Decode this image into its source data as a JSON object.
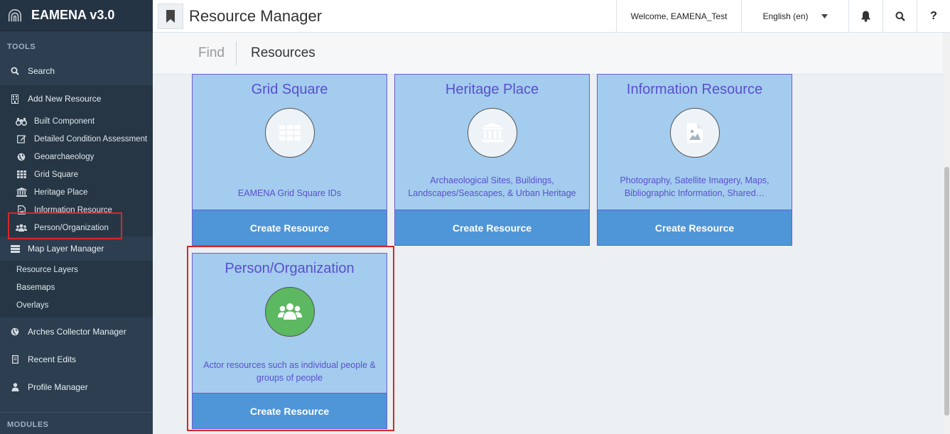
{
  "app": {
    "brand": "EAMENA v3.0"
  },
  "sidebar": {
    "tools_title": "TOOLS",
    "search": "Search",
    "add_new_resource": "Add New Resource",
    "resource_items": [
      {
        "label": "Built Component",
        "icon": "binoculars-icon"
      },
      {
        "label": "Detailed Condition Assessment",
        "icon": "edit-icon"
      },
      {
        "label": "Geoarchaeology",
        "icon": "globe-icon"
      },
      {
        "label": "Grid Square",
        "icon": "grid-icon"
      },
      {
        "label": "Heritage Place",
        "icon": "institution-icon"
      },
      {
        "label": "Information Resource",
        "icon": "image-file-icon"
      },
      {
        "label": "Person/Organization",
        "icon": "users-icon"
      }
    ],
    "map_layer_manager": "Map Layer Manager",
    "map_items": [
      "Resource Layers",
      "Basemaps",
      "Overlays"
    ],
    "arches_collector_manager": "Arches Collector Manager",
    "recent_edits": "Recent Edits",
    "profile_manager": "Profile Manager",
    "modules_title": "MODULES"
  },
  "header": {
    "title": "Resource Manager",
    "welcome": "Welcome, EAMENA_Test",
    "language": "English (en)",
    "help": "?"
  },
  "subheader": {
    "find": "Find",
    "resources": "Resources"
  },
  "cards": [
    {
      "title": "Grid Square",
      "description": "EAMENA Grid Square IDs",
      "button": "Create Resource",
      "icon": "grid-icon"
    },
    {
      "title": "Heritage Place",
      "description": "Archaeological Sites, Buildings, Landscapes/Seascapes, & Urban Heritage",
      "button": "Create Resource",
      "icon": "institution-icon"
    },
    {
      "title": "Information Resource",
      "description": "Photography, Satellite Imagery, Maps, Bibliographic Information, Shared…",
      "button": "Create Resource",
      "icon": "image-file-icon"
    },
    {
      "title": "Person/Organization",
      "description": "Actor resources such as individual people & groups of people",
      "button": "Create Resource",
      "icon": "users-icon"
    }
  ],
  "colors": {
    "sidebar_bg": "#2c3e50",
    "card_bg": "#a3ccee",
    "card_button": "#4f96d8",
    "card_text": "#5a4fcf",
    "highlight": "#d9262a",
    "person_icon_bg": "#5cb861"
  }
}
